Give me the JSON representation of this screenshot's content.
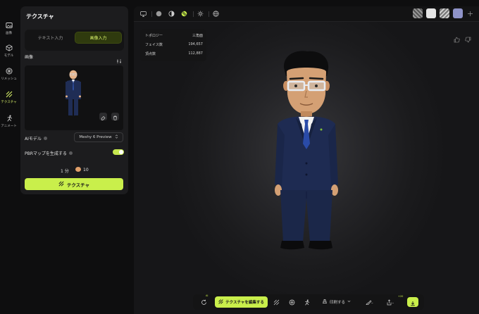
{
  "rail": {
    "items": [
      {
        "label": "画像",
        "icon": "image-icon"
      },
      {
        "label": "モデル",
        "icon": "cube-icon"
      },
      {
        "label": "リメッシュ",
        "icon": "remesh-icon"
      },
      {
        "label": "テクスチャ",
        "icon": "texture-icon"
      },
      {
        "label": "アニメート",
        "icon": "run-icon"
      }
    ]
  },
  "panel": {
    "title": "テクスチャ",
    "tabs": {
      "text": "テキスト入力",
      "image": "画像入力",
      "active": "画像入力"
    },
    "image_section_label": "画像",
    "ai_model_label": "AIモデル",
    "ai_model_value": "Meshy 6 Preview",
    "pbr_label": "PBRマップを生成する",
    "pbr_enabled": true,
    "time_cost": "1 分",
    "credit_cost": "10",
    "submit_label": "テクスチャ"
  },
  "stats": {
    "rows": [
      {
        "label": "トポロジー",
        "value": "三角面"
      },
      {
        "label": "フェイス数",
        "value": "194,657"
      },
      {
        "label": "頂点数",
        "value": "112,887"
      }
    ]
  },
  "bottombar": {
    "edit_label": "テクスチャを編集する",
    "edit_badge": "AI",
    "print_label": "印刷する",
    "download_badge": "+20"
  },
  "colors": {
    "accent": "#c9ef4b",
    "panel_bg": "#1c1c1e",
    "bg": "#0e0e0f",
    "swatch_purple": "#8f93c9"
  }
}
